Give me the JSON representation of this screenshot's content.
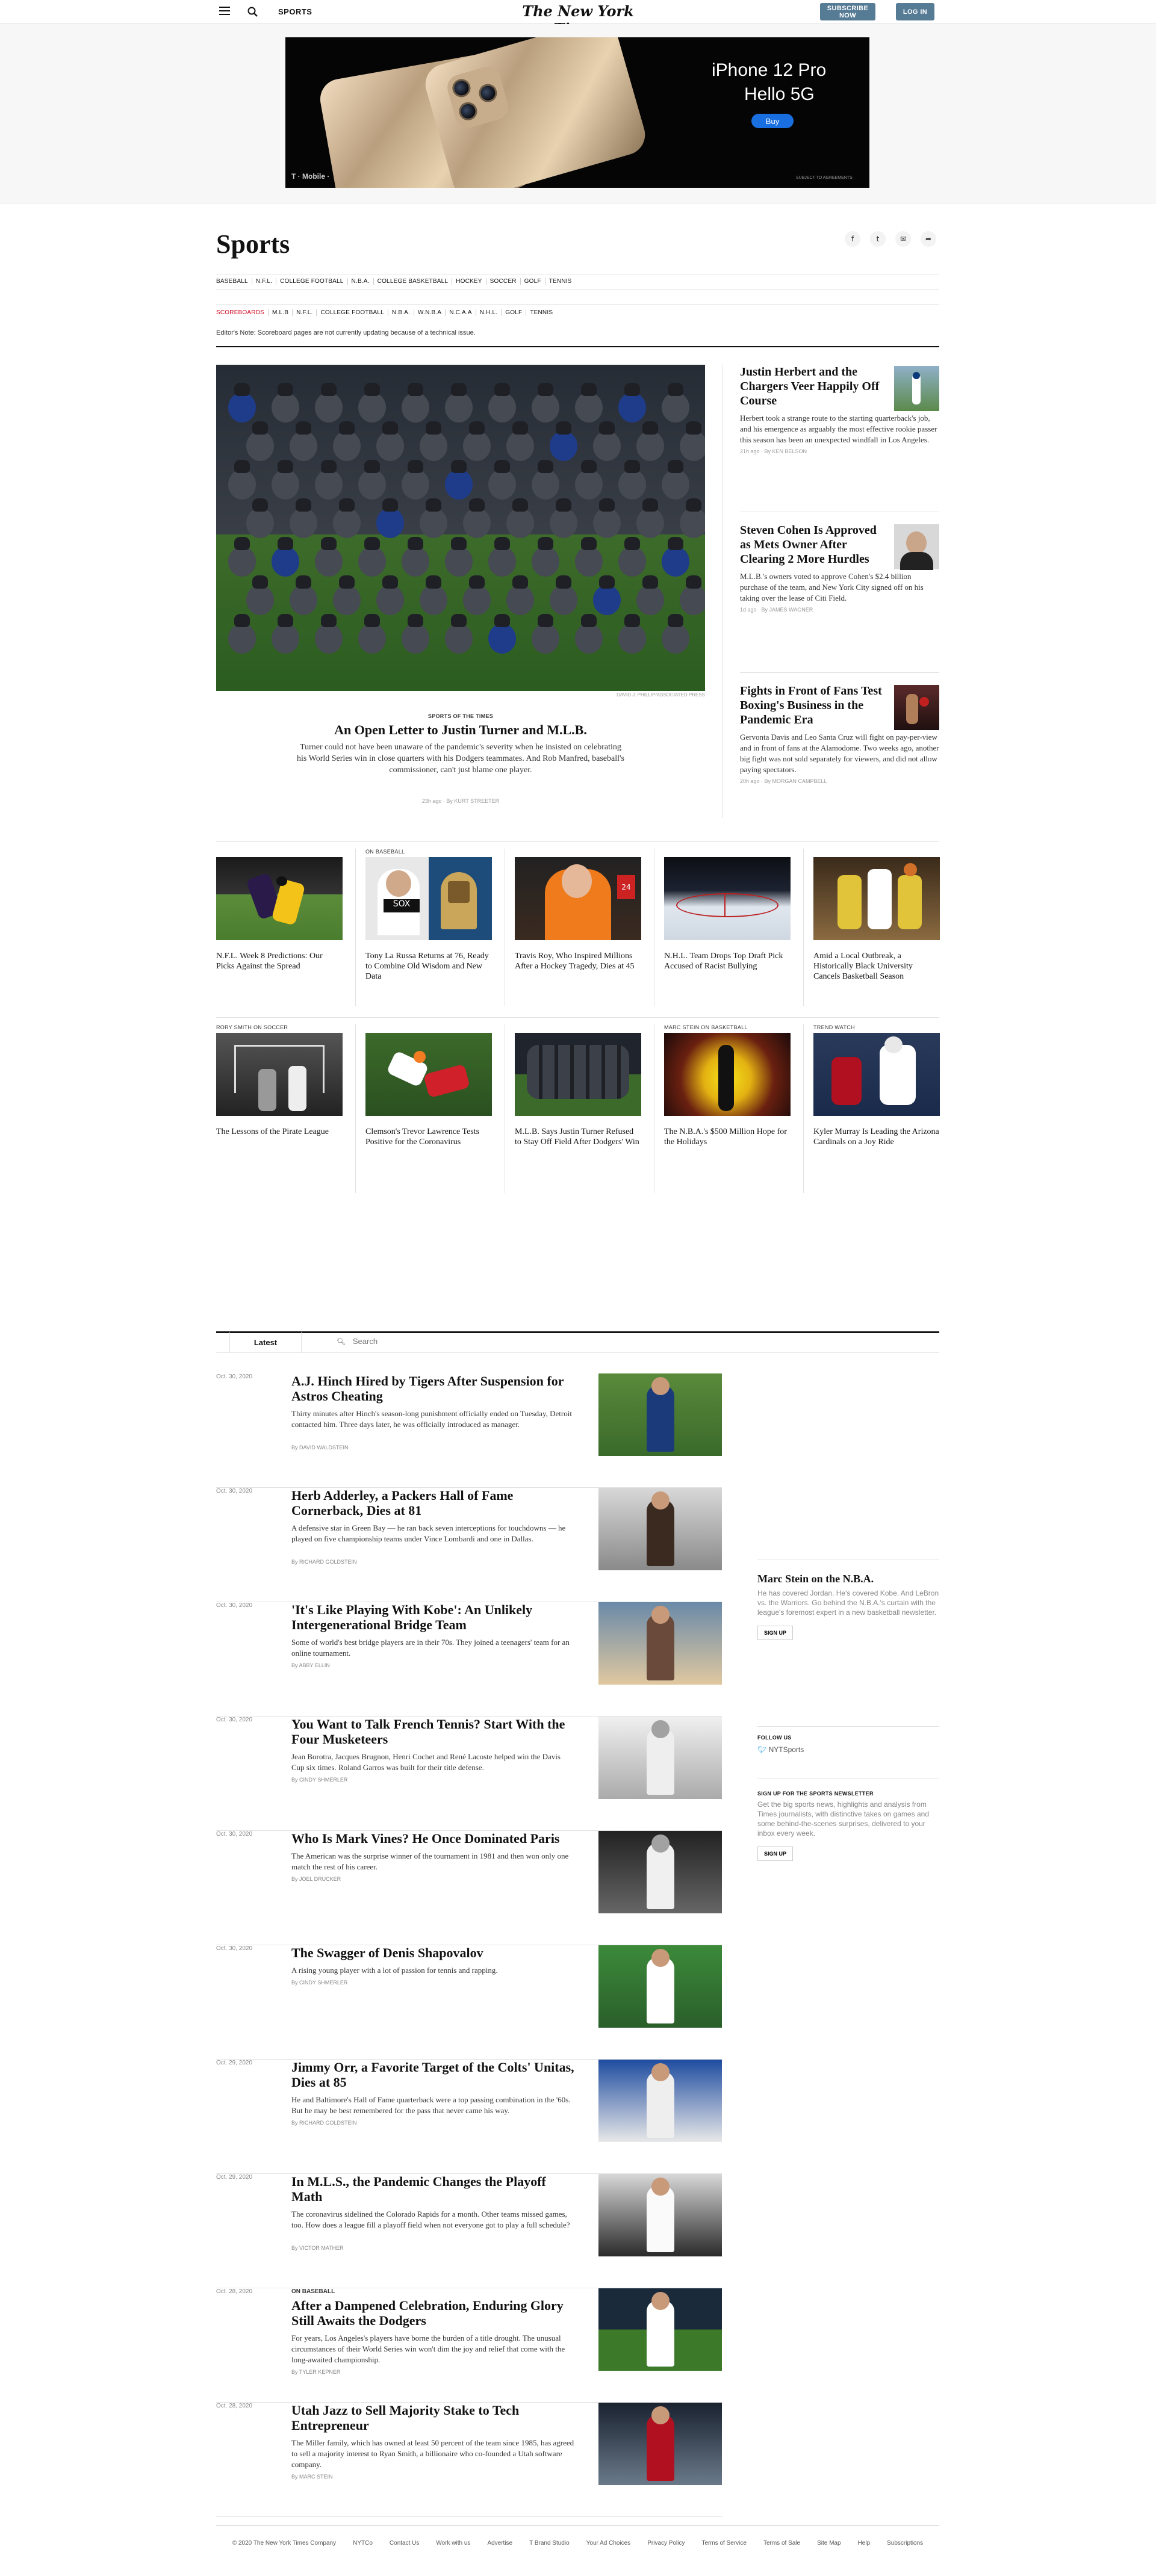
{
  "topbar": {
    "section": "SPORTS",
    "logo": "The New York Times",
    "subscribe": "SUBSCRIBE NOW",
    "login": "LOG IN"
  },
  "ad": {
    "headline": "iPhone 12 Pro",
    "sub": "Hello 5G",
    "buy": "Buy",
    "brand": "T · Mobile ·",
    "fine": "SUBJECT TO AGREEMENTS"
  },
  "header": {
    "title": "Sports",
    "nav": [
      "BASEBALL",
      "N.F.L.",
      "COLLEGE FOOTBALL",
      "N.B.A.",
      "COLLEGE BASKETBALL",
      "HOCKEY",
      "SOCCER",
      "GOLF",
      "TENNIS"
    ],
    "scoreboards": [
      "SCOREBOARDS",
      "M.L.B",
      "N.F.L.",
      "COLLEGE FOOTBALL",
      "N.B.A.",
      "W.N.B.A",
      "N.C.A.A",
      "N.H.L.",
      "GOLF",
      "TENNIS"
    ],
    "note": "Editor's Note: Scoreboard pages are not currently updating because of a technical issue."
  },
  "lead": {
    "credit": "DAVID J. PHILLIP/ASSOCIATED PRESS",
    "kicker": "SPORTS OF THE TIMES",
    "title": "An Open Letter to Justin Turner and M.L.B.",
    "summary": "Turner could not have been unaware of the pandemic's severity when he insisted on celebrating his World Series win in close quarters with his Dodgers teammates. And Rob Manfred, baseball's commissioner, can't just blame one player.",
    "meta": "23h ago  ·  By KURT STREETER"
  },
  "side": [
    {
      "title": "Justin Herbert and the Chargers Veer Happily Off Course",
      "summary": "Herbert took a strange route to the starting quarterback's job, and his emergence as arguably the most effective rookie passer this season has been an unexpected windfall in Los Angeles.",
      "meta": "21h ago  ·  By KEN BELSON"
    },
    {
      "title": "Steven Cohen Is Approved as Mets Owner After Clearing 2 More Hurdles",
      "summary": "M.L.B.'s owners voted to approve Cohen's $2.4 billion purchase of the team, and New York City signed off on his taking over the lease of Citi Field.",
      "meta": "1d ago  ·  By JAMES WAGNER"
    },
    {
      "title": "Fights in Front of Fans Test Boxing's Business in the Pandemic Era",
      "summary": "Gervonta Davis and Leo Santa Cruz will fight on pay-per-view and in front of fans at the Alamodome. Two weeks ago, another big fight was not sold separately for viewers, and did not allow paying spectators.",
      "meta": "20h ago  ·  By MORGAN CAMPBELL"
    }
  ],
  "row1": [
    {
      "kicker": "",
      "title": "N.F.L. Week 8 Predictions: Our Picks Against the Spread"
    },
    {
      "kicker": "ON BASEBALL",
      "title": "Tony La Russa Returns at 76, Ready to Combine Old Wisdom and New Data"
    },
    {
      "kicker": "",
      "title": "Travis Roy, Who Inspired Millions After a Hockey Tragedy, Dies at 45"
    },
    {
      "kicker": "",
      "title": "N.H.L. Team Drops Top Draft Pick Accused of Racist Bullying"
    },
    {
      "kicker": "",
      "title": "Amid a Local Outbreak, a Historically Black University Cancels Basketball Season"
    }
  ],
  "row2": [
    {
      "kicker": "RORY SMITH ON SOCCER",
      "title": "The Lessons of the Pirate League"
    },
    {
      "kicker": "",
      "title": "Clemson's Trevor Lawrence Tests Positive for the Coronavirus"
    },
    {
      "kicker": "",
      "title": "M.L.B. Says Justin Turner Refused to Stay Off Field After Dodgers' Win"
    },
    {
      "kicker": "MARC STEIN ON BASKETBALL",
      "title": "The N.B.A.'s $500 Million Hope for the Holidays"
    },
    {
      "kicker": "TREND WATCH",
      "title": "Kyler Murray Is Leading the Arizona Cardinals on a Joy Ride"
    }
  ],
  "latest": {
    "tab": "Latest",
    "search_placeholder": "Search",
    "stories": [
      {
        "date": "Oct. 30, 2020",
        "kicker": "",
        "title": "A.J. Hinch Hired by Tigers After Suspension for Astros Cheating",
        "summary": "Thirty minutes after Hinch's season-long punishment officially ended on Tuesday, Detroit contacted him. Three days later, he was officially introduced as manager.",
        "byline": "By DAVID WALDSTEIN"
      },
      {
        "date": "Oct. 30, 2020",
        "kicker": "",
        "title": "Herb Adderley, a Packers Hall of Fame Cornerback, Dies at 81",
        "summary": "A defensive star in Green Bay — he ran back seven interceptions for touchdowns — he played on five championship teams under Vince Lombardi and one in Dallas.",
        "byline": "By RICHARD GOLDSTEIN"
      },
      {
        "date": "Oct. 30, 2020",
        "kicker": "",
        "title": "'It's Like Playing With Kobe': An Unlikely Intergenerational Bridge Team",
        "summary": "Some of world's best bridge players are in their 70s. They joined a teenagers' team for an online tournament.",
        "byline": "By ABBY ELLIN"
      },
      {
        "date": "Oct. 30, 2020",
        "kicker": "",
        "title": "You Want to Talk French Tennis? Start With the Four Musketeers",
        "summary": "Jean Borotra, Jacques Brugnon, Henri Cochet and René Lacoste helped win the Davis Cup six times. Roland Garros was built for their title defense.",
        "byline": "By CINDY SHMERLER"
      },
      {
        "date": "Oct. 30, 2020",
        "kicker": "",
        "title": "Who Is Mark Vines? He Once Dominated Paris",
        "summary": "The American was the surprise winner of the tournament in 1981 and then won only one match the rest of his career.",
        "byline": "By JOEL DRUCKER"
      },
      {
        "date": "Oct. 30, 2020",
        "kicker": "",
        "title": "The Swagger of Denis Shapovalov",
        "summary": "A rising young player with a lot of passion for tennis and rapping.",
        "byline": "By CINDY SHMERLER"
      },
      {
        "date": "Oct. 29, 2020",
        "kicker": "",
        "title": "Jimmy Orr, a Favorite Target of the Colts' Unitas, Dies at 85",
        "summary": "He and Baltimore's Hall of Fame quarterback were a top passing combination in the '60s. But he may be best remembered for the pass that never came his way.",
        "byline": "By RICHARD GOLDSTEIN"
      },
      {
        "date": "Oct. 29, 2020",
        "kicker": "",
        "title": "In M.L.S., the Pandemic Changes the Playoff Math",
        "summary": "The coronavirus sidelined the Colorado Rapids for a month. Other teams missed games, too. How does a league fill a playoff field when not everyone got to play a full schedule?",
        "byline": "By VICTOR MATHER"
      },
      {
        "date": "Oct. 28, 2020",
        "kicker": "ON BASEBALL",
        "title": "After a Dampened Celebration, Enduring Glory Still Awaits the Dodgers",
        "summary": "For years, Los Angeles's players have borne the burden of a title drought. The unusual circumstances of their World Series win won't dim the joy and relief that come with the long-awaited championship.",
        "byline": "By TYLER KEPNER"
      },
      {
        "date": "Oct. 28, 2020",
        "kicker": "",
        "title": "Utah Jazz to Sell Majority Stake to Tech Entrepreneur",
        "summary": "The Miller family, which has owned at least 50 percent of the team since 1985, has agreed to sell a majority interest to Ryan Smith, a billionaire who co-founded a Utah software company.",
        "byline": "By MARC STEIN"
      }
    ]
  },
  "rail": {
    "stein_title": "Marc Stein on the N.B.A.",
    "stein_text": "He has covered Jordan. He's covered Kobe. And LeBron vs. the Warriors. Go behind the N.B.A.'s curtain with the league's foremost expert in a new basketball newsletter.",
    "signup": "SIGN UP",
    "follow_label": "FOLLOW US",
    "twitter": "NYTSports",
    "newsletter_label": "SIGN UP FOR THE SPORTS NEWSLETTER",
    "newsletter_text": "Get the big sports news, highlights and analysis from Times journalists, with distinctive takes on games and some behind-the-scenes surprises, delivered to your inbox every week."
  },
  "footer": [
    "© 2020 The New York Times Company",
    "NYTCo",
    "Contact Us",
    "Work with us",
    "Advertise",
    "T Brand Studio",
    "Your Ad Choices",
    "Privacy Policy",
    "Terms of Service",
    "Terms of Sale",
    "Site Map",
    "Help",
    "Subscriptions"
  ]
}
